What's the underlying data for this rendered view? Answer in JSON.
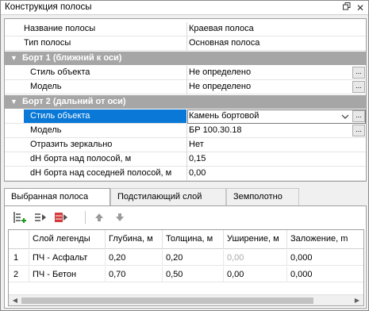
{
  "window": {
    "title": "Конструкция полосы",
    "pin_icon": "restore-window-icon",
    "close_icon": "close-icon"
  },
  "properties": {
    "top": [
      {
        "name": "Название полосы",
        "value": "Краевая полоса"
      },
      {
        "name": "Тип полосы",
        "value": "Основная полоса"
      }
    ],
    "cat1": {
      "title": "Борт 1 (ближний к оси)",
      "rows": [
        {
          "name": "Стиль объекта",
          "value": "Не определено",
          "button": "..."
        },
        {
          "name": "Модель",
          "value": "Не определено",
          "button": "..."
        }
      ]
    },
    "cat2": {
      "title": "Борт 2 (дальний от оси)",
      "rows": [
        {
          "name": "Стиль объекта",
          "value": "Камень бортовой",
          "button": "..."
        },
        {
          "name": "Модель",
          "value": "БР 100.30.18",
          "button": "..."
        },
        {
          "name": "Отразить зеркально",
          "value": "Нет"
        },
        {
          "name": "dH борта над полосой, м",
          "value": "0,15"
        },
        {
          "name": "dH борта над соседней полосой, м",
          "value": "0,00"
        }
      ]
    }
  },
  "tabs": [
    "Выбранная полоса",
    "Подстилающий слой",
    "Земполотно"
  ],
  "toolbar": {
    "icons": [
      "insert-layer-icon",
      "insert-after-icon",
      "delete-layer-icon",
      "move-up-icon",
      "move-down-icon"
    ]
  },
  "layers_table": {
    "columns": [
      "",
      "Слой легенды",
      "Глубина, м",
      "Толщина, м",
      "Уширение, м",
      "Заложение, m"
    ],
    "rows": [
      [
        "1",
        "ПЧ - Асфальт",
        "0,20",
        "0,20",
        "0,00",
        "0,000"
      ],
      [
        "2",
        "ПЧ - Бетон",
        "0,70",
        "0,50",
        "0,00",
        "0,000"
      ]
    ]
  },
  "colors": {
    "category_bg": "#a6a6a6",
    "selection": "#0a78d7"
  }
}
